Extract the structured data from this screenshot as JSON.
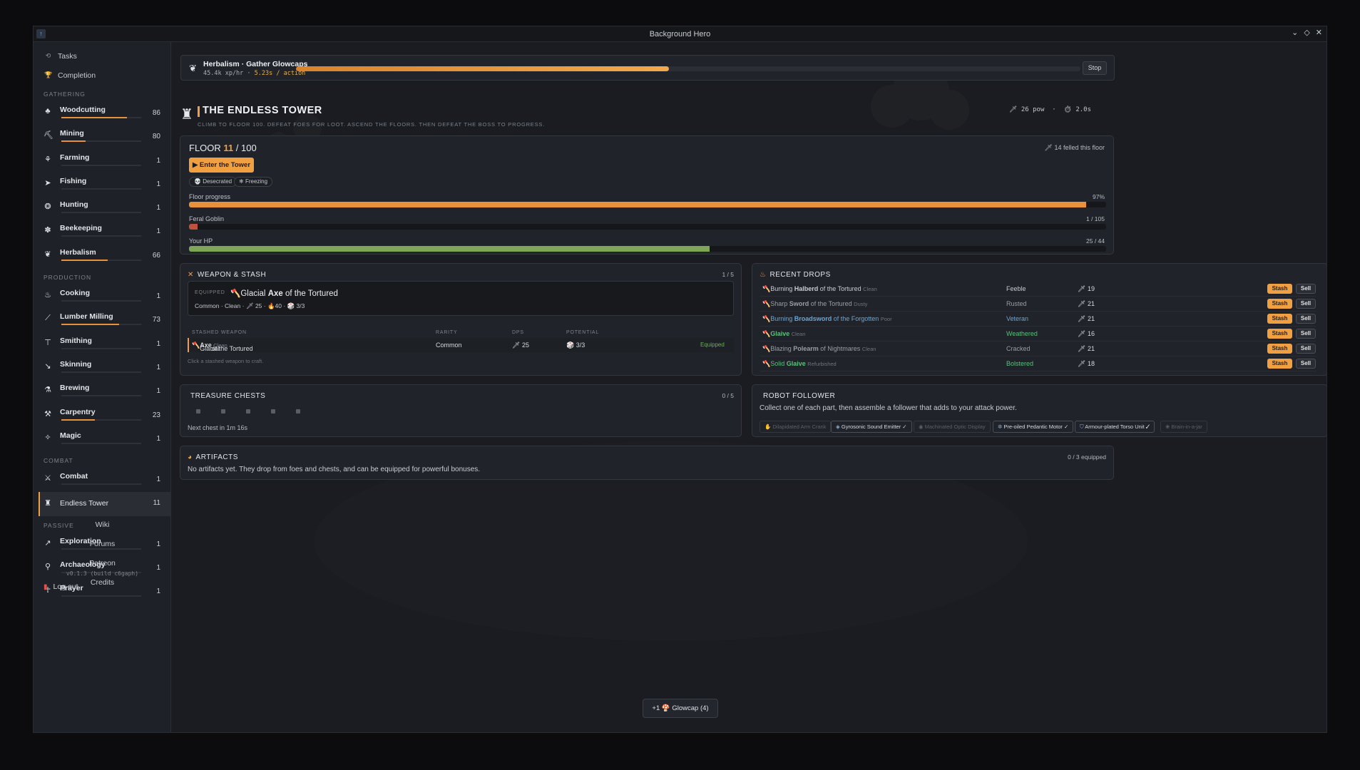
{
  "window": {
    "title": "Background Hero"
  },
  "sidebar": {
    "top_links": [
      {
        "label": "Tasks",
        "icon": "tasks-icon"
      },
      {
        "label": "Completion",
        "icon": "trophy-icon"
      }
    ],
    "sections": [
      {
        "title": "GATHERING",
        "skills": [
          {
            "name": "Woodcutting",
            "level": "86",
            "icon": "tree-icon",
            "progress": 0.82
          },
          {
            "name": "Mining",
            "level": "80",
            "icon": "pickaxe-icon",
            "progress": 0.3
          },
          {
            "name": "Farming",
            "level": "1",
            "icon": "farming-icon",
            "progress": 0
          },
          {
            "name": "Fishing",
            "level": "1",
            "icon": "fish-icon",
            "progress": 0
          },
          {
            "name": "Hunting",
            "level": "1",
            "icon": "paw-icon",
            "progress": 0
          },
          {
            "name": "Beekeeping",
            "level": "1",
            "icon": "bee-icon",
            "progress": 0
          },
          {
            "name": "Herbalism",
            "level": "66",
            "icon": "herb-icon",
            "progress": 0.58
          }
        ]
      },
      {
        "title": "PRODUCTION",
        "skills": [
          {
            "name": "Cooking",
            "level": "1",
            "icon": "cooking-icon",
            "progress": 0
          },
          {
            "name": "Lumber Milling",
            "level": "73",
            "icon": "saw-icon",
            "progress": 0.72
          },
          {
            "name": "Smithing",
            "level": "1",
            "icon": "anvil-icon",
            "progress": 0
          },
          {
            "name": "Skinning",
            "level": "1",
            "icon": "knife-icon",
            "progress": 0
          },
          {
            "name": "Brewing",
            "level": "1",
            "icon": "potion-icon",
            "progress": 0
          },
          {
            "name": "Carpentry",
            "level": "23",
            "icon": "hammer-icon",
            "progress": 0.42
          },
          {
            "name": "Magic",
            "level": "1",
            "icon": "magic-icon",
            "progress": 0
          }
        ]
      },
      {
        "title": "COMBAT",
        "skills": [
          {
            "name": "Combat",
            "level": "1",
            "icon": "sword-icon",
            "progress": 0
          },
          {
            "name": "Endless Tower",
            "level": "11",
            "icon": "rook-icon",
            "progress": 0,
            "active": true
          }
        ]
      },
      {
        "title": "PASSIVE",
        "skills": [
          {
            "name": "Exploration",
            "level": "1",
            "icon": "compass-icon",
            "progress": 0
          },
          {
            "name": "Archaeology",
            "level": "1",
            "icon": "shovel-icon",
            "progress": 0
          },
          {
            "name": "Prayer",
            "level": "1",
            "icon": "prayer-icon",
            "progress": 0
          }
        ]
      }
    ],
    "footer_links": [
      "Wiki",
      "Forums",
      "Patreon",
      "Credits"
    ],
    "version": "v0.1.3 (build c6gaph)",
    "logout": "Log out"
  },
  "task": {
    "name": "Herbalism · Gather Glowcaps",
    "rate": "45.4k xp/hr · ",
    "speed": "5.23s / action",
    "progress": 0.475,
    "stop": "Stop"
  },
  "tower": {
    "title": "THE ENDLESS TOWER",
    "subtitle": "Climb to floor 100. Defeat foes for loot. Ascend the floors. Then defeat the boss to progress.",
    "pow": "26 pow",
    "sep": "·",
    "time": "2.0s"
  },
  "floor": {
    "label": "FLOOR",
    "current": "11",
    "total": " / 100",
    "felled": "14 felled this floor",
    "enter": "▶ Enter the Tower",
    "modifiers": [
      "Desecrated",
      "Freezing"
    ],
    "bars": [
      {
        "label": "Floor progress",
        "value": "97%",
        "fraction": 0.978,
        "color": "#e8913a"
      },
      {
        "label": "Feral Goblin",
        "value": "1 / 105",
        "fraction": 0.0095,
        "color": "#c0513c"
      },
      {
        "label": "Your HP",
        "value": "25 / 44",
        "fraction": 0.568,
        "color": "#7fa656"
      }
    ]
  },
  "weapon": {
    "title": "WEAPON & STASH",
    "count": "1 / 5",
    "equipped_tag": "EQUIPPED",
    "equipped_name": {
      "prefix": "Glacial ",
      "base": "Axe",
      "suffix": " of the Tortured"
    },
    "equipped_sub": "Common · Clean · 🗡 25 · 🔥40 · 🎲 3/3",
    "headers": [
      "STASHED WEAPON",
      "RARITY",
      "DPS",
      "POTENTIAL"
    ],
    "row": {
      "prefix": "Glacial ",
      "base": "Axe",
      "suffix": " of the Tortured",
      "cond": "Clean",
      "rarity": "Common",
      "dps": "25",
      "potential": "3/3",
      "status": "Equipped"
    },
    "hint": "Click a stashed weapon to craft."
  },
  "drops": {
    "title": "RECENT DROPS",
    "items": [
      {
        "prefix": "Burning ",
        "base": "Halberd",
        "suffix": " of the Tortured",
        "cond": "Clean",
        "quality": "Feeble",
        "dps": "19",
        "color": "#c9ccd2",
        "qcolor": "#c9ccd2"
      },
      {
        "prefix": "Sharp ",
        "base": "Sword",
        "suffix": " of the Tortured",
        "cond": "Dusty",
        "quality": "Rusted",
        "dps": "21",
        "color": "#9a9ea6",
        "qcolor": "#9a9ea6"
      },
      {
        "prefix": "Burning ",
        "base": "Broadsword",
        "suffix": " of the Forgotten",
        "cond": "Poor",
        "quality": "Veteran",
        "dps": "21",
        "color": "#6aa6d8",
        "qcolor": "#6aa6d8"
      },
      {
        "prefix": "",
        "base": "Glaive",
        "suffix": "",
        "cond": "Clean",
        "quality": "Weathered",
        "dps": "16",
        "color": "#5fbf7f",
        "qcolor": "#5fbf7f"
      },
      {
        "prefix": "Blazing ",
        "base": "Polearm",
        "suffix": " of Nightmares",
        "cond": "Clean",
        "quality": "Cracked",
        "dps": "21",
        "color": "#9a9ea6",
        "qcolor": "#9a9ea6"
      },
      {
        "prefix": "Solid ",
        "base": "Glaive",
        "suffix": "",
        "cond": "Refurbished",
        "quality": "Bolstered",
        "dps": "18",
        "color": "#5fbf7f",
        "qcolor": "#5fbf7f"
      }
    ],
    "stash": "Stash",
    "sell": "Sell"
  },
  "chests": {
    "title": "TREASURE CHESTS",
    "count": "0 / 5",
    "next": "Next chest in 1m 16s",
    "slots": 5
  },
  "robot": {
    "title": "ROBOT FOLLOWER",
    "desc": "Collect one of each part, then assemble a follower that adds to your attack power.",
    "parts": [
      {
        "label": "Dilapidated Arm Crank",
        "owned": false,
        "icon": "arm-icon"
      },
      {
        "label": "Gyrosonic Sound Emitter ✓",
        "owned": true,
        "icon": "speaker-icon"
      },
      {
        "label": "Machinated Optic Display",
        "owned": false,
        "icon": "eye-icon"
      },
      {
        "label": "Pre-oiled Pedantic Motor ✓",
        "owned": true,
        "icon": "gear-icon"
      },
      {
        "label": "Armour-plated Torso Unit ✓",
        "owned": true,
        "icon": "shield-icon"
      },
      {
        "label": "Brain-in-a-jar",
        "owned": false,
        "icon": "brain-icon"
      }
    ]
  },
  "artifacts": {
    "title": "ARTIFACTS",
    "count": "0 / 3 equipped",
    "desc": "No artifacts yet. They drop from foes and chests, and can be equipped for powerful bonuses."
  },
  "toast": {
    "text": "+1 🍄 Glowcap (4)"
  }
}
